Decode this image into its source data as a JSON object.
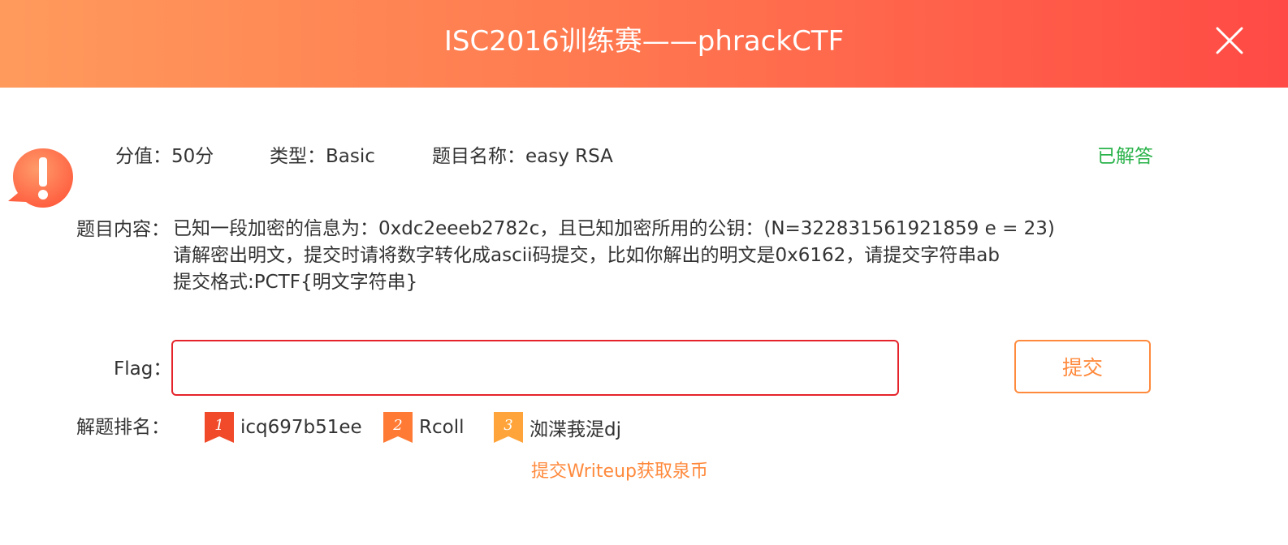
{
  "header": {
    "title": "ISC2016训练赛——phrackCTF"
  },
  "icons": {
    "close": "close-icon",
    "alert": "exclamation-bubble-icon"
  },
  "meta": {
    "score": "分值：50分",
    "type": "类型：Basic",
    "name": "题目名称：easy RSA",
    "status": "已解答"
  },
  "content": {
    "label": "题目内容：",
    "lines": [
      "已知一段加密的信息为：0xdc2eeeb2782c，且已知加密所用的公钥：(N=322831561921859 e = 23)",
      "请解密出明文，提交时请将数字转化成ascii码提交，比如你解出的明文是0x6162，请提交字符串ab",
      "提交格式:PCTF{明文字符串}"
    ]
  },
  "flag": {
    "label": "Flag：",
    "value": "",
    "placeholder": ""
  },
  "submit_label": "提交",
  "ranking": {
    "label": "解题排名：",
    "entries": [
      {
        "rank": "1",
        "name": "icq697b51ee",
        "color": "#f04a2a"
      },
      {
        "rank": "2",
        "name": "Rcoll",
        "color": "#ff7a35"
      },
      {
        "rank": "3",
        "name": "洳渫莪湜dj",
        "color": "#ffa43a"
      }
    ]
  },
  "writeup_link": "提交Writeup获取泉币",
  "colors": {
    "accent": "#ff8a3d",
    "status_green": "#2bb34b",
    "input_border": "#e5232b"
  }
}
